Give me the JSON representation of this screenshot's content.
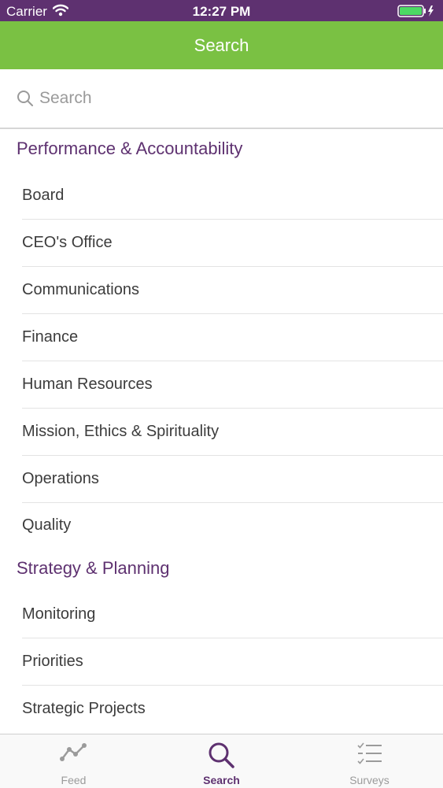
{
  "status_bar": {
    "carrier": "Carrier",
    "time": "12:27 PM"
  },
  "nav": {
    "title": "Search"
  },
  "search": {
    "placeholder": "Search"
  },
  "sections": [
    {
      "title": "Performance & Accountability",
      "items": [
        "Board",
        "CEO's Office",
        "Communications",
        "Finance",
        "Human Resources",
        "Mission, Ethics & Spirituality",
        "Operations",
        "Quality"
      ]
    },
    {
      "title": "Strategy & Planning",
      "items": [
        "Monitoring",
        "Priorities",
        "Strategic Projects"
      ]
    }
  ],
  "tabs": [
    {
      "label": "Feed",
      "icon": "line-chart-icon"
    },
    {
      "label": "Search",
      "icon": "search-icon"
    },
    {
      "label": "Surveys",
      "icon": "checklist-icon"
    }
  ],
  "colors": {
    "status_bar": "#5e3170",
    "nav_bar": "#7ac143",
    "section_title": "#5e3170",
    "active_tab": "#5e3170",
    "inactive_tab": "#9b9b9b",
    "battery": "#4cd964"
  }
}
